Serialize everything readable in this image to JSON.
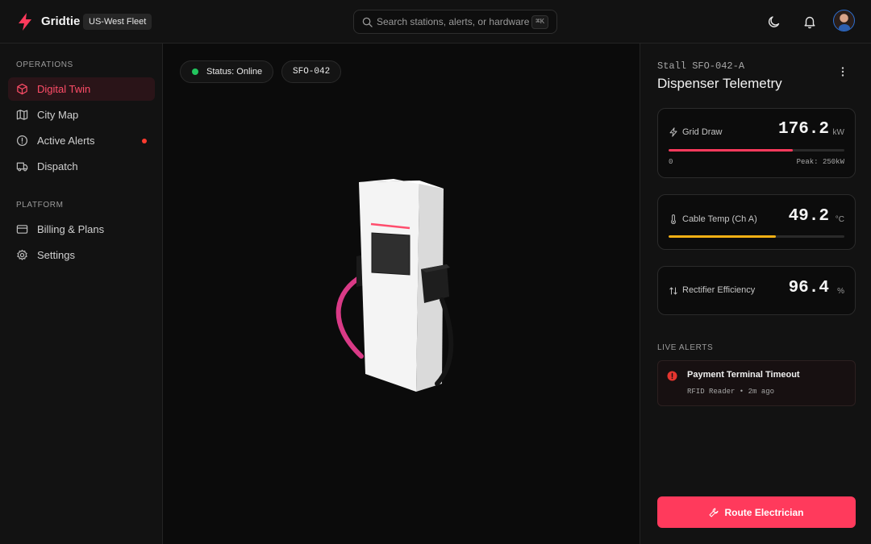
{
  "app": {
    "brand": "Gridtie",
    "fleet": "US-West Fleet",
    "accent": "#ff3a5c"
  },
  "search": {
    "placeholder": "Search stations, alerts, or hardware...",
    "shortcut": "⌘K"
  },
  "header": {
    "icons": [
      "moon-icon",
      "bell-icon"
    ]
  },
  "sidebar": {
    "operations_label": "OPERATIONS",
    "platform_label": "PLATFORM",
    "operations": [
      {
        "label": "Digital Twin",
        "icon": "cube-icon",
        "active": true
      },
      {
        "label": "City Map",
        "icon": "map-icon"
      },
      {
        "label": "Active Alerts",
        "icon": "alert-circle-icon",
        "indicator": true
      },
      {
        "label": "Dispatch",
        "icon": "truck-icon"
      }
    ],
    "platform": [
      {
        "label": "Billing & Plans",
        "icon": "credit-card-icon"
      },
      {
        "label": "Settings",
        "icon": "gear-icon"
      }
    ]
  },
  "viewport": {
    "status": "Status: Online",
    "station_id": "SFO-042"
  },
  "panel": {
    "stall": "Stall SFO-042-A",
    "title": "Dispenser Telemetry",
    "metrics": {
      "grid_draw": {
        "label": "Grid Draw",
        "value": "176.2",
        "unit": "kW",
        "min_label": "0",
        "peak_label": "Peak: 250kW",
        "fraction": 0.705,
        "color": "#ff3a5c"
      },
      "cable_temp": {
        "label": "Cable Temp (Ch A)",
        "value": "49.2",
        "unit": "°C",
        "fraction": 0.61,
        "color": "#f5b014"
      },
      "efficiency": {
        "label": "Rectifier Efficiency",
        "value": "96.4",
        "unit": "%"
      }
    },
    "alerts_label": "LIVE ALERTS",
    "alerts": [
      {
        "title": "Payment Terminal Timeout",
        "meta": "RFID Reader • 2m ago"
      }
    ],
    "cta_label": "Route Electrician"
  }
}
